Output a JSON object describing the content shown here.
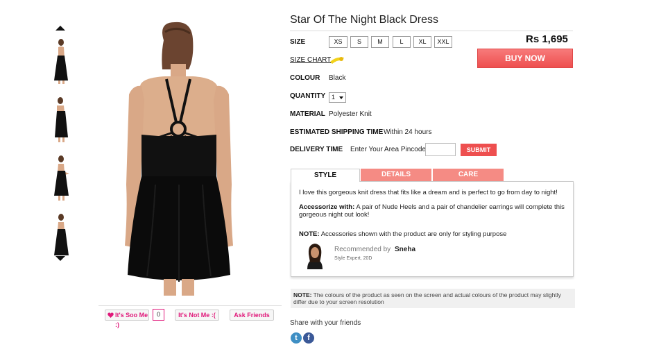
{
  "product": {
    "title": "Star Of The Night Black Dress",
    "price": "Rs 1,695",
    "buy_label": "BUY NOW",
    "size_label": "SIZE",
    "sizes": [
      "XS",
      "S",
      "M",
      "L",
      "XL",
      "XXL"
    ],
    "size_chart_label": "SIZE CHART",
    "colour_label": "COLOUR",
    "colour_value": "Black",
    "quantity_label": "QUANTITY",
    "quantity_value": "1",
    "material_label": "MATERIAL",
    "material_value": "Polyester Knit",
    "shipping_label": "ESTIMATED SHIPPING TIME",
    "shipping_value": "Within 24 hours",
    "delivery_label": "DELIVERY TIME",
    "pincode_prompt": "Enter Your Area Pincode",
    "submit_label": "SUBMIT"
  },
  "tabs": [
    {
      "label": "STYLE",
      "active": true
    },
    {
      "label": "DETAILS",
      "active": false
    },
    {
      "label": "CARE",
      "active": false
    }
  ],
  "style_panel": {
    "description": "I love this gorgeous knit dress that fits like a dream and is perfect to go from day to night!",
    "accessorize_heading": "Accessorize with:",
    "accessorize_text": "A pair of Nude Heels and a pair of chandelier earrings will complete this gorgeous night out look!",
    "note_heading": "NOTE:",
    "note_text": "Accessories shown with the product are only for styling purpose",
    "recommended_by": "Recommended by",
    "recommender_name": "Sneha",
    "recommender_title": "Style Expert, 20D"
  },
  "colour_note": {
    "heading": "NOTE:",
    "text": "The colours of the product as seen on the screen and actual colours of the product may slightly differ due to your screen resolution"
  },
  "social": {
    "love_label": "It's Soo Me :)",
    "love_count": "0",
    "not_me_label": "It's Not Me :(",
    "ask_label": "Ask Friends",
    "share_label": "Share with your friends",
    "share_icons": [
      "twitter-icon",
      "facebook-icon"
    ]
  },
  "colors": {
    "accent": "#ee4f4f",
    "tab_inactive": "#f58b84",
    "pink": "#e0187a"
  }
}
